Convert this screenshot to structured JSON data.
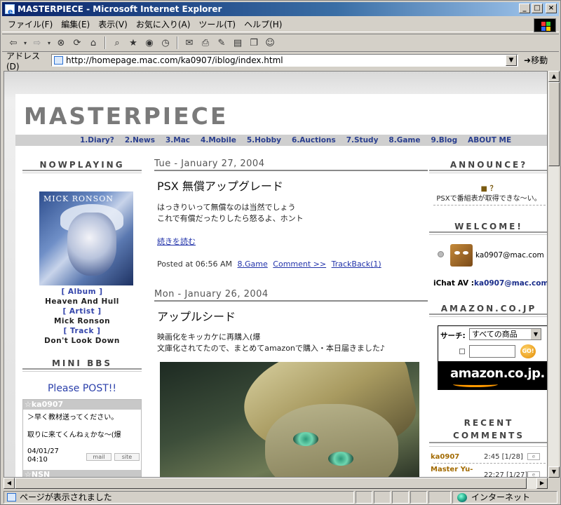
{
  "window": {
    "title": "MASTERPIECE - Microsoft Internet Explorer",
    "min": "_",
    "max": "□",
    "close": "×"
  },
  "menu": [
    "ファイル(F)",
    "編集(E)",
    "表示(V)",
    "お気に入り(A)",
    "ツール(T)",
    "ヘルプ(H)"
  ],
  "address": {
    "label": "アドレス(D)",
    "url": "http://homepage.mac.com/ka0907/iblog/index.html",
    "go": "移動"
  },
  "status": {
    "text": "ページが表示されました",
    "zone": "インターネット"
  },
  "site": {
    "title": "MASTERPIECE",
    "nav": [
      "1.Diary?",
      "2.News",
      "3.Mac",
      "4.Mobile",
      "5.Hobby",
      "6.Auctions",
      "7.Study",
      "8.Game",
      "9.Blog",
      "ABOUT ME"
    ]
  },
  "left": {
    "nowplaying": "NOWPLAYING",
    "album_cover_text": "MICK RONSON",
    "album_label": "[ Album ]",
    "album": "Heaven And Hull",
    "artist_label": "[ Artist ]",
    "artist": "Mick Ronson",
    "track_label": "[ Track ]",
    "track": "Don't Look Down",
    "minibbs": "MINI BBS",
    "bbs_prompt": "Please POST!!",
    "bbs_posts": [
      {
        "author": "☆ka0907",
        "line1": "＞早く教材送ってください。",
        "line2": "取りに来てくんねぇかな～(爆",
        "date": "04/01/27",
        "time": "04:10",
        "mail": "mail",
        "site": "site"
      },
      {
        "author": "☆NSN"
      }
    ]
  },
  "posts": [
    {
      "date": "Tue - January 27, 2004",
      "title": "PSX 無償アップグレード",
      "line1": "はっきりいって無償なのは当然でしょう",
      "line2": "これで有償だったりしたら怒るよ、ホント",
      "more": "続きを読む",
      "posted": "Posted at 06:56 AM",
      "category": "8.Game",
      "comment": "Comment >>",
      "trackback": "TrackBack(1)"
    },
    {
      "date": "Mon - January 26, 2004",
      "title": "アップルシード",
      "line1": "映画化をキッカケに再購入(爆",
      "line2": "文庫化されてたので、まとめてamazonで購入・本日届きました♪"
    }
  ],
  "right": {
    "announce": "ANNOUNCE?",
    "announce_mark": "■ ？",
    "announce_text": "PSXで番組表が取得できな～い。",
    "welcome": "WELCOME!",
    "welcome_user": "ka0907@mac.com",
    "ichat_label": "iChat AV :",
    "ichat": "ka0907@mac.com",
    "amazon": "AMAZON.CO.JP",
    "amz_search_label": "サーチ:",
    "amz_select": "すべての商品",
    "amz_go": "GO!",
    "amz_logo": "amazon.co.jp.",
    "recent_line1": "RECENT",
    "recent_line2": "COMMENTS",
    "comments": [
      {
        "name": "ka0907",
        "time": "2:45 [1/28]",
        "e": "e"
      },
      {
        "name": "Master Yu-",
        "time": "22:27 [1/27]",
        "e": "e"
      }
    ]
  }
}
